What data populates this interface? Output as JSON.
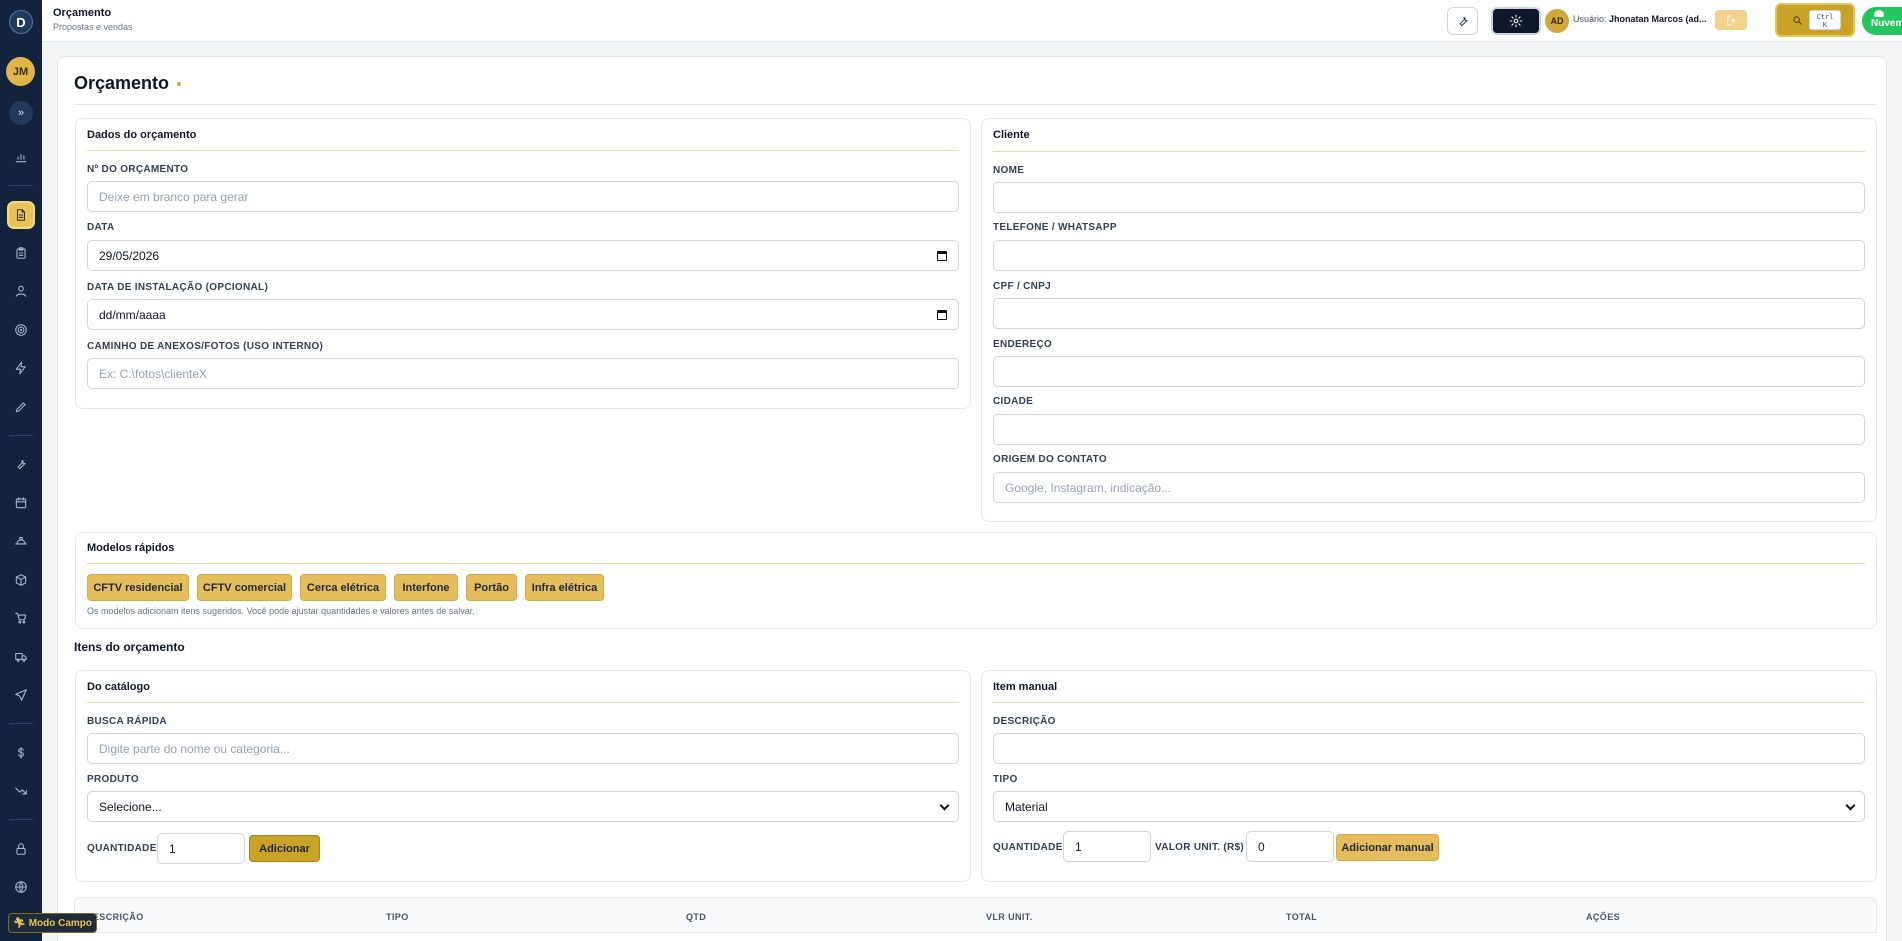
{
  "app": {
    "logo_letter": "D",
    "user_initials": "JM"
  },
  "topbar": {
    "title": "Orçamento",
    "subtitle": "Propostas e vendas",
    "avatar": "AD",
    "user_prefix": "Usuário:",
    "user_name": "Jhonatan Marcos (ad...",
    "search_shortcut_line1": "Ctrl",
    "search_shortcut_line2": "K",
    "cloud_label": "Nuvem"
  },
  "sidebar": {
    "expand_label": "»",
    "modo_campo": "Modo Campo",
    "icons": [
      "bar-chart-icon",
      "document-icon",
      "clipboard-icon",
      "user-icon",
      "target-icon",
      "bolt-icon",
      "pencil-icon",
      "wrench-icon",
      "calendar-icon",
      "hard-hat-icon",
      "box-icon",
      "cart-icon",
      "truck-icon",
      "send-icon",
      "dollar-icon",
      "trending-down-icon",
      "lock-icon",
      "globe-icon"
    ]
  },
  "page": {
    "title": "Orçamento"
  },
  "dados": {
    "title": "Dados do orçamento",
    "numero_label": "Nº DO ORÇAMENTO",
    "numero_placeholder": "Deixe em branco para gerar",
    "data_label": "DATA",
    "data_value": "29/05/2026",
    "instalacao_label": "DATA DE INSTALAÇÃO (OPCIONAL)",
    "instalacao_value": "dd/mm/aaaa",
    "anexos_label": "CAMINHO DE ANEXOS/FOTOS (USO INTERNO)",
    "anexos_placeholder": "Ex: C:\\fotos\\clienteX"
  },
  "cliente": {
    "title": "Cliente",
    "nome_label": "NOME",
    "telefone_label": "TELEFONE / WHATSAPP",
    "cpf_label": "CPF / CNPJ",
    "endereco_label": "ENDEREÇO",
    "cidade_label": "CIDADE",
    "origem_label": "ORIGEM DO CONTATO",
    "origem_placeholder": "Google, Instagram, indicação..."
  },
  "modelos": {
    "title": "Modelos rápidos",
    "chips": [
      "CFTV residencial",
      "CFTV comercial",
      "Cerca elétrica",
      "Interfone",
      "Portão",
      "Infra elétrica"
    ],
    "hint": "Os modelos adicionam itens sugeridos. Você pode ajustar quantidades e valores antes de salvar."
  },
  "itens": {
    "title": "Itens do orçamento",
    "catalogo": {
      "title": "Do catálogo",
      "busca_label": "BUSCA RÁPIDA",
      "busca_placeholder": "Digite parte do nome ou categoria...",
      "produto_label": "PRODUTO",
      "produto_value": "Selecione...",
      "quantidade_label": "QUANTIDADE",
      "quantidade_value": "1",
      "add_label": "Adicionar"
    },
    "manual": {
      "title": "Item manual",
      "descricao_label": "DESCRIÇÃO",
      "tipo_label": "TIPO",
      "tipo_value": "Material",
      "quantidade_label": "QUANTIDADE",
      "quantidade_value": "1",
      "valor_label": "VALOR UNIT. (R$)",
      "valor_value": "0",
      "add_label": "Adicionar manual"
    },
    "table_headers": [
      "DESCRIÇÃO",
      "TIPO",
      "QTD",
      "VLR UNIT.",
      "TOTAL",
      "AÇÕES"
    ]
  },
  "colors": {
    "sidebar_bg": "#13233d",
    "accent_gold": "#e8c357",
    "cloud_green": "#22c55e"
  }
}
